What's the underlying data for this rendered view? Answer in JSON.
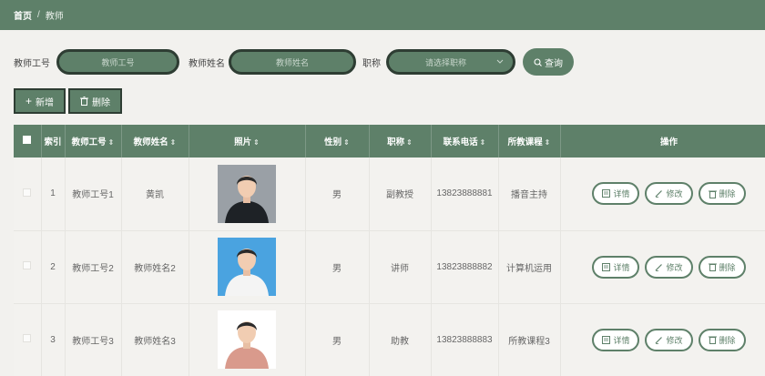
{
  "breadcrumb": {
    "home": "首页",
    "separator": "/",
    "current": "教师"
  },
  "search": {
    "id_label": "教师工号",
    "id_placeholder": "教师工号",
    "name_label": "教师姓名",
    "name_placeholder": "教师姓名",
    "title_label": "职称",
    "title_placeholder": "请选择职称",
    "query_label": "查询"
  },
  "actions": {
    "add_label": "新增",
    "delete_label": "删除"
  },
  "table": {
    "headers": {
      "index": "索引",
      "teacher_id": "教师工号",
      "teacher_name": "教师姓名",
      "photo": "照片",
      "gender": "性别",
      "title": "职称",
      "phone": "联系电话",
      "course": "所教课程",
      "ops": "操作"
    },
    "rows": [
      {
        "index": "1",
        "teacher_id": "教师工号1",
        "teacher_name": "黄凯",
        "gender": "男",
        "title": "副教授",
        "phone": "13823888881",
        "course": "播音主持",
        "photo_bg": "#9aa0a6",
        "photo_suit": "#1e2226"
      },
      {
        "index": "2",
        "teacher_id": "教师工号2",
        "teacher_name": "教师姓名2",
        "gender": "男",
        "title": "讲师",
        "phone": "13823888882",
        "course": "计算机运用",
        "photo_bg": "#4aa3e0",
        "photo_suit": "#f4f4f4"
      },
      {
        "index": "3",
        "teacher_id": "教师工号3",
        "teacher_name": "教师姓名3",
        "gender": "男",
        "title": "助教",
        "phone": "13823888883",
        "course": "所教课程3",
        "photo_bg": "#ffffff",
        "photo_suit": "#d99a8c"
      }
    ],
    "row_ops": {
      "detail": "详情",
      "edit": "修改",
      "delete": "删除"
    }
  },
  "colors": {
    "accent": "#5e8069",
    "border_dark": "#2e3d33"
  }
}
